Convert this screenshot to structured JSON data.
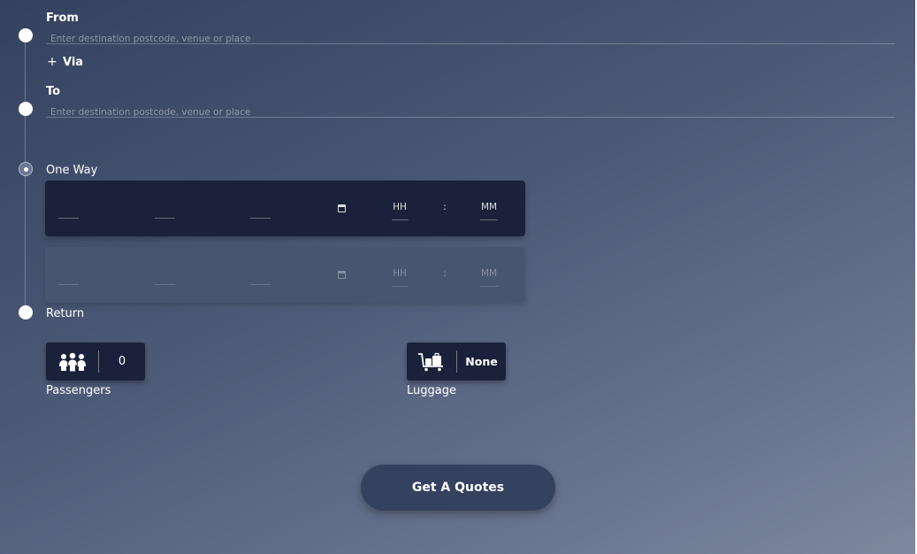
{
  "route": {
    "from_label": "From",
    "from_placeholder": "Enter destination postcode, venue or place",
    "via_symbol": "+",
    "via_label": "Via",
    "to_label": "To",
    "to_placeholder": "Enter destination postcode, venue or place"
  },
  "trip": {
    "one_way_label": "One Way",
    "return_label": "Return",
    "selected": "One Way",
    "outbound": {
      "hour_placeholder": "HH",
      "separator": ":",
      "minute_placeholder": "MM"
    },
    "return": {
      "hour_placeholder": "HH",
      "separator": ":",
      "minute_placeholder": "MM"
    }
  },
  "passengers": {
    "icon": "people-group-icon",
    "value": "0",
    "label": "Passengers"
  },
  "luggage": {
    "icon": "luggage-trolley-icon",
    "value": "None",
    "label": "Luggage"
  },
  "submit": {
    "label": "Get A Quotes"
  },
  "colors": {
    "bg_top": "#34425f",
    "bg_bottom": "#7e889f",
    "field_dark": "#19223a",
    "field_disabled": "#48556f",
    "button": "#34415f"
  }
}
